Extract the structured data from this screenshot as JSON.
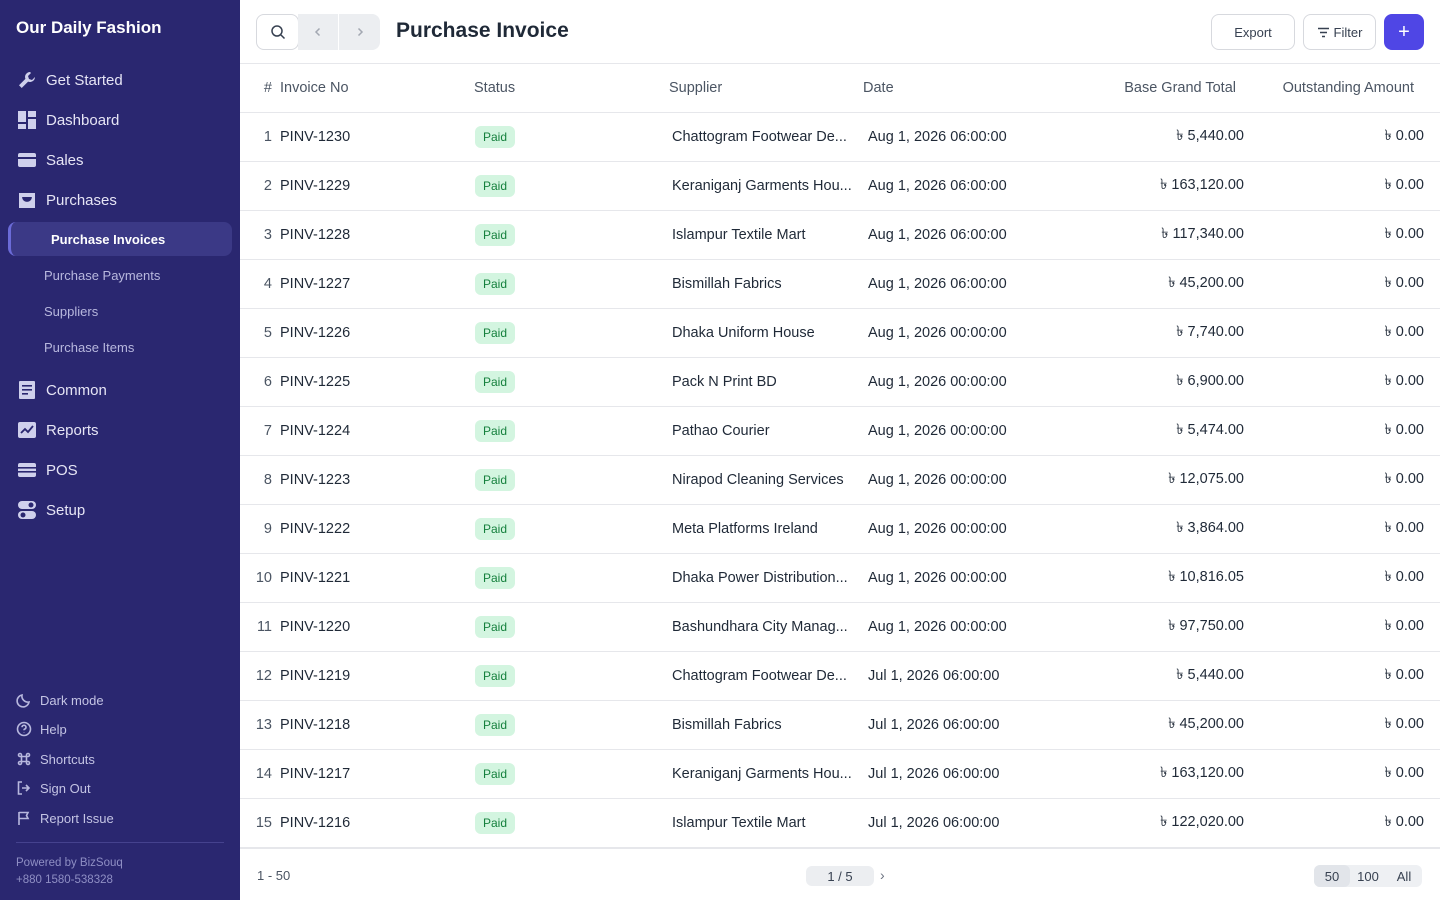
{
  "app": {
    "name": "Our Daily Fashion"
  },
  "sidebar": {
    "items": [
      {
        "label": "Get Started",
        "icon": "tools-icon"
      },
      {
        "label": "Dashboard",
        "icon": "dashboard-icon"
      },
      {
        "label": "Sales",
        "icon": "card-icon"
      },
      {
        "label": "Purchases",
        "icon": "bag-icon"
      },
      {
        "label": "Common",
        "icon": "list-icon"
      },
      {
        "label": "Reports",
        "icon": "chart-icon"
      },
      {
        "label": "POS",
        "icon": "pos-icon"
      },
      {
        "label": "Setup",
        "icon": "toggle-icon"
      }
    ],
    "sub_items": [
      "Purchase Invoices",
      "Purchase Payments",
      "Suppliers",
      "Purchase Items"
    ],
    "utility": [
      "Dark mode",
      "Help",
      "Shortcuts",
      "Sign Out",
      "Report Issue"
    ],
    "powered_by": "Powered by BizSouq",
    "phone": "+880 1580-538328"
  },
  "header": {
    "title": "Purchase Invoice",
    "export_label": "Export",
    "filter_label": "Filter",
    "add_label": "+"
  },
  "table": {
    "columns": {
      "idx": "#",
      "invoice": "Invoice No",
      "status": "Status",
      "supplier": "Supplier",
      "date": "Date",
      "total": "Base Grand Total",
      "outstanding": "Outstanding Amount"
    },
    "rows": [
      {
        "idx": "1",
        "invoice": "PINV-1230",
        "status": "Paid",
        "supplier": "Chattogram Footwear De...",
        "date": "Aug 1, 2026 06:00:00",
        "total": "৳ 5,440.00",
        "outstanding": "৳ 0.00"
      },
      {
        "idx": "2",
        "invoice": "PINV-1229",
        "status": "Paid",
        "supplier": "Keraniganj Garments Hou...",
        "date": "Aug 1, 2026 06:00:00",
        "total": "৳ 163,120.00",
        "outstanding": "৳ 0.00"
      },
      {
        "idx": "3",
        "invoice": "PINV-1228",
        "status": "Paid",
        "supplier": "Islampur Textile Mart",
        "date": "Aug 1, 2026 06:00:00",
        "total": "৳ 117,340.00",
        "outstanding": "৳ 0.00"
      },
      {
        "idx": "4",
        "invoice": "PINV-1227",
        "status": "Paid",
        "supplier": "Bismillah Fabrics",
        "date": "Aug 1, 2026 06:00:00",
        "total": "৳ 45,200.00",
        "outstanding": "৳ 0.00"
      },
      {
        "idx": "5",
        "invoice": "PINV-1226",
        "status": "Paid",
        "supplier": "Dhaka Uniform House",
        "date": "Aug 1, 2026 00:00:00",
        "total": "৳ 7,740.00",
        "outstanding": "৳ 0.00"
      },
      {
        "idx": "6",
        "invoice": "PINV-1225",
        "status": "Paid",
        "supplier": "Pack N Print BD",
        "date": "Aug 1, 2026 00:00:00",
        "total": "৳ 6,900.00",
        "outstanding": "৳ 0.00"
      },
      {
        "idx": "7",
        "invoice": "PINV-1224",
        "status": "Paid",
        "supplier": "Pathao Courier",
        "date": "Aug 1, 2026 00:00:00",
        "total": "৳ 5,474.00",
        "outstanding": "৳ 0.00"
      },
      {
        "idx": "8",
        "invoice": "PINV-1223",
        "status": "Paid",
        "supplier": "Nirapod Cleaning Services",
        "date": "Aug 1, 2026 00:00:00",
        "total": "৳ 12,075.00",
        "outstanding": "৳ 0.00"
      },
      {
        "idx": "9",
        "invoice": "PINV-1222",
        "status": "Paid",
        "supplier": "Meta Platforms Ireland",
        "date": "Aug 1, 2026 00:00:00",
        "total": "৳ 3,864.00",
        "outstanding": "৳ 0.00"
      },
      {
        "idx": "10",
        "invoice": "PINV-1221",
        "status": "Paid",
        "supplier": "Dhaka Power Distribution...",
        "date": "Aug 1, 2026 00:00:00",
        "total": "৳ 10,816.05",
        "outstanding": "৳ 0.00"
      },
      {
        "idx": "11",
        "invoice": "PINV-1220",
        "status": "Paid",
        "supplier": "Bashundhara City Manag...",
        "date": "Aug 1, 2026 00:00:00",
        "total": "৳ 97,750.00",
        "outstanding": "৳ 0.00"
      },
      {
        "idx": "12",
        "invoice": "PINV-1219",
        "status": "Paid",
        "supplier": "Chattogram Footwear De...",
        "date": "Jul 1, 2026 06:00:00",
        "total": "৳ 5,440.00",
        "outstanding": "৳ 0.00"
      },
      {
        "idx": "13",
        "invoice": "PINV-1218",
        "status": "Paid",
        "supplier": "Bismillah Fabrics",
        "date": "Jul 1, 2026 06:00:00",
        "total": "৳ 45,200.00",
        "outstanding": "৳ 0.00"
      },
      {
        "idx": "14",
        "invoice": "PINV-1217",
        "status": "Paid",
        "supplier": "Keraniganj Garments Hou...",
        "date": "Jul 1, 2026 06:00:00",
        "total": "৳ 163,120.00",
        "outstanding": "৳ 0.00"
      },
      {
        "idx": "15",
        "invoice": "PINV-1216",
        "status": "Paid",
        "supplier": "Islampur Textile Mart",
        "date": "Jul 1, 2026 06:00:00",
        "total": "৳ 122,020.00",
        "outstanding": "৳ 0.00"
      }
    ]
  },
  "footer": {
    "range": "1 - 50",
    "page": "1 / 5",
    "next": "›",
    "page_sizes": [
      "50",
      "100",
      "All"
    ]
  },
  "colors": {
    "sidebar_bg": "#2a2770",
    "accent": "#4f46e5",
    "paid_bg": "#d3f5e0",
    "paid_text": "#15803d"
  }
}
